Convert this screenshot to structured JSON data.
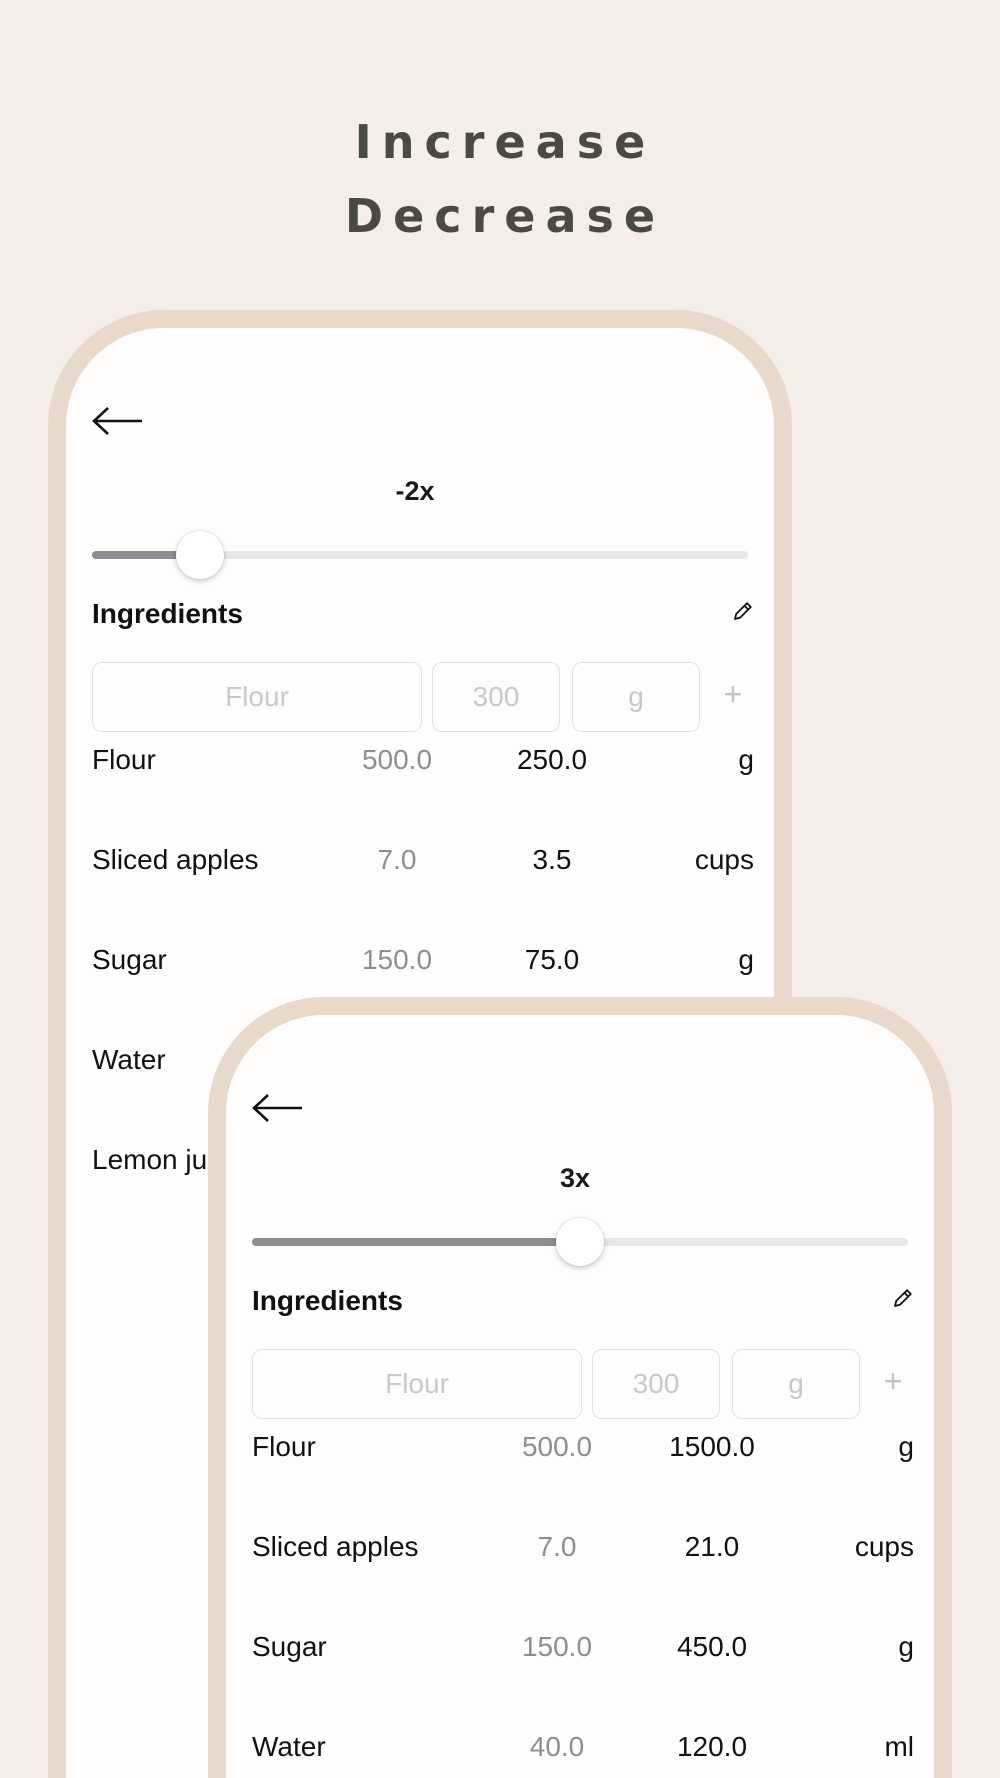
{
  "headline": {
    "line1": "Increase",
    "line2": "Decrease"
  },
  "colors": {
    "background": "#f5ede8",
    "frame": "#e9d9cb",
    "slider_fill": "#8e8c90",
    "slider_track": "#e8e7ea"
  },
  "screens": [
    {
      "back_icon": "arrow-left-icon",
      "factor_label": "-2x",
      "slider_value": 0.165,
      "ingredients_title": "Ingredients",
      "edit_icon": "pencil-icon",
      "inputs": {
        "name_placeholder": "Flour",
        "qty_placeholder": "300",
        "unit_placeholder": "g"
      },
      "add_symbol": "+",
      "rows": [
        {
          "name": "Flour",
          "original": "500.0",
          "scaled": "250.0",
          "unit": "g"
        },
        {
          "name": "Sliced apples",
          "original": "7.0",
          "scaled": "3.5",
          "unit": "cups"
        },
        {
          "name": "Sugar",
          "original": "150.0",
          "scaled": "75.0",
          "unit": "g"
        },
        {
          "name": "Water",
          "original": "",
          "scaled": "",
          "unit": ""
        },
        {
          "name": "Lemon juice",
          "original": "",
          "scaled": "",
          "unit": ""
        }
      ]
    },
    {
      "back_icon": "arrow-left-icon",
      "factor_label": "3x",
      "slider_value": 0.5,
      "ingredients_title": "Ingredients",
      "edit_icon": "pencil-icon",
      "inputs": {
        "name_placeholder": "Flour",
        "qty_placeholder": "300",
        "unit_placeholder": "g"
      },
      "add_symbol": "+",
      "rows": [
        {
          "name": "Flour",
          "original": "500.0",
          "scaled": "1500.0",
          "unit": "g"
        },
        {
          "name": "Sliced apples",
          "original": "7.0",
          "scaled": "21.0",
          "unit": "cups"
        },
        {
          "name": "Sugar",
          "original": "150.0",
          "scaled": "450.0",
          "unit": "g"
        },
        {
          "name": "Water",
          "original": "40.0",
          "scaled": "120.0",
          "unit": "ml"
        }
      ]
    }
  ]
}
